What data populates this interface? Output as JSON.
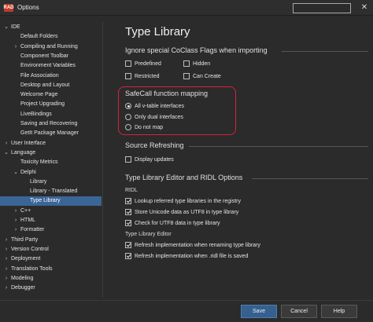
{
  "window": {
    "title": "Options",
    "app_badge": "RAD",
    "close": "✕"
  },
  "tree": [
    {
      "label": "IDE",
      "level": 0,
      "arrow": "expanded"
    },
    {
      "label": "Default Folders",
      "level": 1,
      "arrow": "none"
    },
    {
      "label": "Compiling and Running",
      "level": 1,
      "arrow": "collapsed"
    },
    {
      "label": "Component Toolbar",
      "level": 1,
      "arrow": "none"
    },
    {
      "label": "Environment Variables",
      "level": 1,
      "arrow": "none"
    },
    {
      "label": "File Association",
      "level": 1,
      "arrow": "none"
    },
    {
      "label": "Desktop and Layout",
      "level": 1,
      "arrow": "none"
    },
    {
      "label": "Welcome Page",
      "level": 1,
      "arrow": "none"
    },
    {
      "label": "Project Upgrading",
      "level": 1,
      "arrow": "none"
    },
    {
      "label": "LiveBindings",
      "level": 1,
      "arrow": "none"
    },
    {
      "label": "Saving and Recovering",
      "level": 1,
      "arrow": "none"
    },
    {
      "label": "GetIt Package Manager",
      "level": 1,
      "arrow": "none"
    },
    {
      "label": "User Interface",
      "level": 0,
      "arrow": "collapsed"
    },
    {
      "label": "Language",
      "level": 0,
      "arrow": "expanded"
    },
    {
      "label": "Toxicity Metrics",
      "level": 1,
      "arrow": "none"
    },
    {
      "label": "Delphi",
      "level": 1,
      "arrow": "expanded"
    },
    {
      "label": "Library",
      "level": 2,
      "arrow": "none"
    },
    {
      "label": "Library - Translated",
      "level": 2,
      "arrow": "none"
    },
    {
      "label": "Type Library",
      "level": 2,
      "arrow": "none",
      "selected": true
    },
    {
      "label": "C++",
      "level": 1,
      "arrow": "collapsed"
    },
    {
      "label": "HTML",
      "level": 1,
      "arrow": "collapsed"
    },
    {
      "label": "Formatter",
      "level": 1,
      "arrow": "collapsed"
    },
    {
      "label": "Third Party",
      "level": 0,
      "arrow": "collapsed"
    },
    {
      "label": "Version Control",
      "level": 0,
      "arrow": "collapsed"
    },
    {
      "label": "Deployment",
      "level": 0,
      "arrow": "collapsed"
    },
    {
      "label": "Translation Tools",
      "level": 0,
      "arrow": "collapsed"
    },
    {
      "label": "Modeling",
      "level": 0,
      "arrow": "collapsed"
    },
    {
      "label": "Debugger",
      "level": 0,
      "arrow": "collapsed"
    }
  ],
  "page": {
    "title": "Type Library",
    "coclass": {
      "title": "Ignore special CoClass Flags when importing",
      "predefined": {
        "label": "Predefined",
        "checked": false
      },
      "hidden": {
        "label": "Hidden",
        "checked": false
      },
      "restricted": {
        "label": "Restricted",
        "checked": false
      },
      "can_create": {
        "label": "Can Create",
        "checked": false
      }
    },
    "safecall": {
      "title": "SafeCall function mapping",
      "options": [
        {
          "label": "All v-table interfaces",
          "selected": true
        },
        {
          "label": "Only dual interfaces",
          "selected": false
        },
        {
          "label": "Do not map",
          "selected": false
        }
      ],
      "highlight_color": "#d9213b"
    },
    "refreshing": {
      "title": "Source Refreshing",
      "display_updates": {
        "label": "Display updates",
        "checked": false
      }
    },
    "editor": {
      "title": "Type Library Editor and RIDL Options",
      "ridl_label": "RIDL",
      "lookup": {
        "label": "Lookup referred type libraries in the registry",
        "checked": true
      },
      "unicode": {
        "label": "Store Unicode data as UTF8 in type library",
        "checked": true
      },
      "check_utf8": {
        "label": "Check for UTF8 data in type library",
        "checked": true
      },
      "tle_label": "Type Library Editor",
      "refresh_renaming": {
        "label": "Refresh implementation when renaming type library",
        "checked": true
      },
      "refresh_ridl": {
        "label": "Refresh implementation when .ridl file is saved",
        "checked": true
      }
    }
  },
  "buttons": {
    "save": "Save",
    "cancel": "Cancel",
    "help": "Help"
  },
  "colors": {
    "accent": "#3b6596",
    "primary_button": "#35608f"
  }
}
